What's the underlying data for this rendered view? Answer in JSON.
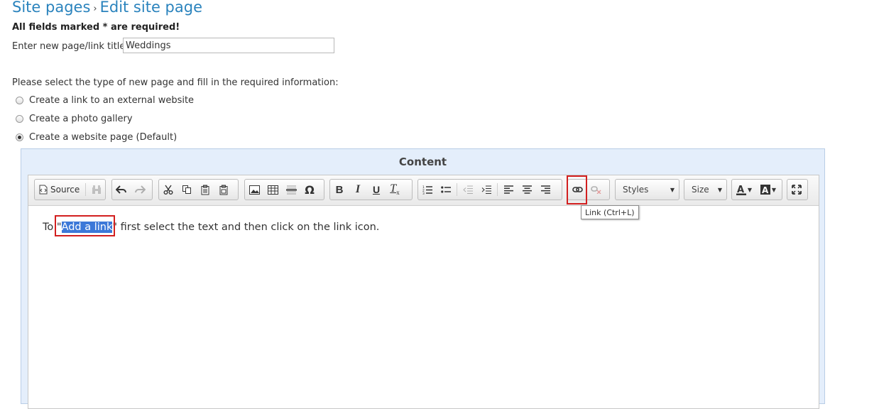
{
  "breadcrumb": {
    "parent": "Site pages",
    "separator": "›",
    "current": "Edit site page"
  },
  "required_note": "All fields marked * are required!",
  "title_field": {
    "label": "Enter new page/link title:",
    "value": "Weddings"
  },
  "type_prompt": "Please select the type of new page and fill in the required information:",
  "page_types": [
    {
      "label": "Create a link to an external website",
      "checked": false
    },
    {
      "label": "Create a photo gallery",
      "checked": false
    },
    {
      "label": "Create a website page (Default)",
      "checked": true
    }
  ],
  "content": {
    "title": "Content",
    "toolbar": {
      "source_label": "Source",
      "styles_label": "Styles",
      "size_label": "Size",
      "link_tooltip": "Link (Ctrl+L)"
    },
    "body": {
      "prefix": "To \"",
      "selected": "Add a link",
      "suffix": "\" first select the text and then click on the link icon."
    }
  },
  "colors": {
    "accent": "#2a83bd",
    "highlight": "#d21f1f",
    "selection": "#3c78d8",
    "panel": "#e4eefb"
  }
}
